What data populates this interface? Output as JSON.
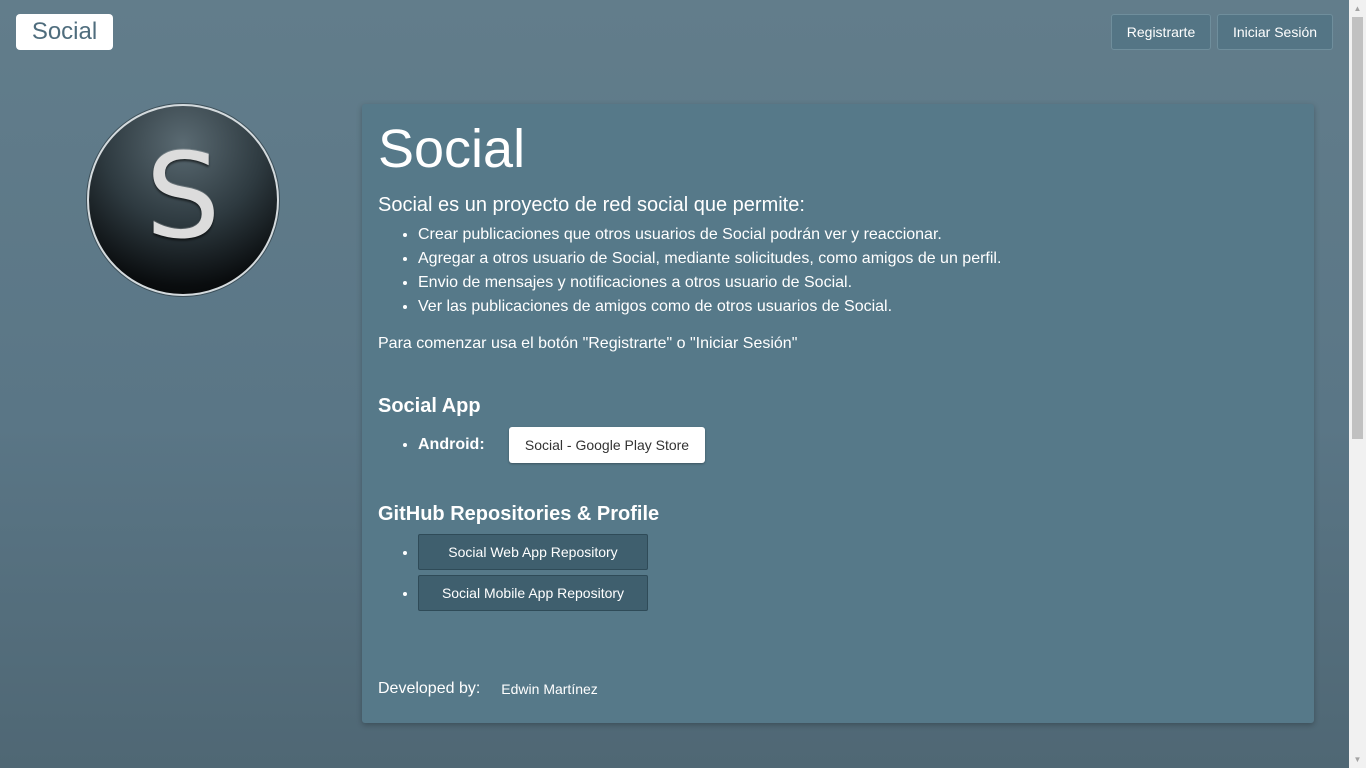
{
  "navbar": {
    "brand": "Social",
    "register_label": "Registrarte",
    "login_label": "Iniciar Sesión"
  },
  "logo": {
    "letter": "S"
  },
  "main": {
    "title": "Social",
    "intro": "Social es un proyecto de red social que permite:",
    "features": [
      "Crear publicaciones que otros usuarios de Social podrán ver y reaccionar.",
      "Agregar a otros usuario de Social, mediante solicitudes, como amigos de un perfil.",
      "Envio de mensajes y notificaciones a otros usuario de Social.",
      "Ver las publicaciones de amigos como de otros usuarios de Social."
    ],
    "cta": "Para comenzar usa el botón \"Registrarte\" o \"Iniciar Sesión\"",
    "app_section": {
      "title": "Social App",
      "android_label": "Android:",
      "play_store_button": "Social - Google Play Store"
    },
    "github_section": {
      "title": "GitHub Repositories & Profile",
      "web_repo_button": "Social Web App Repository",
      "mobile_repo_button": "Social Mobile App Repository"
    },
    "footer": {
      "developed_by": "Developed by:",
      "developer_name": "Edwin Martínez"
    }
  },
  "colors": {
    "background": "#5d7987",
    "card": "#567989",
    "repo_button": "#3f5f6e",
    "brand_text": "#4f6d7d"
  }
}
